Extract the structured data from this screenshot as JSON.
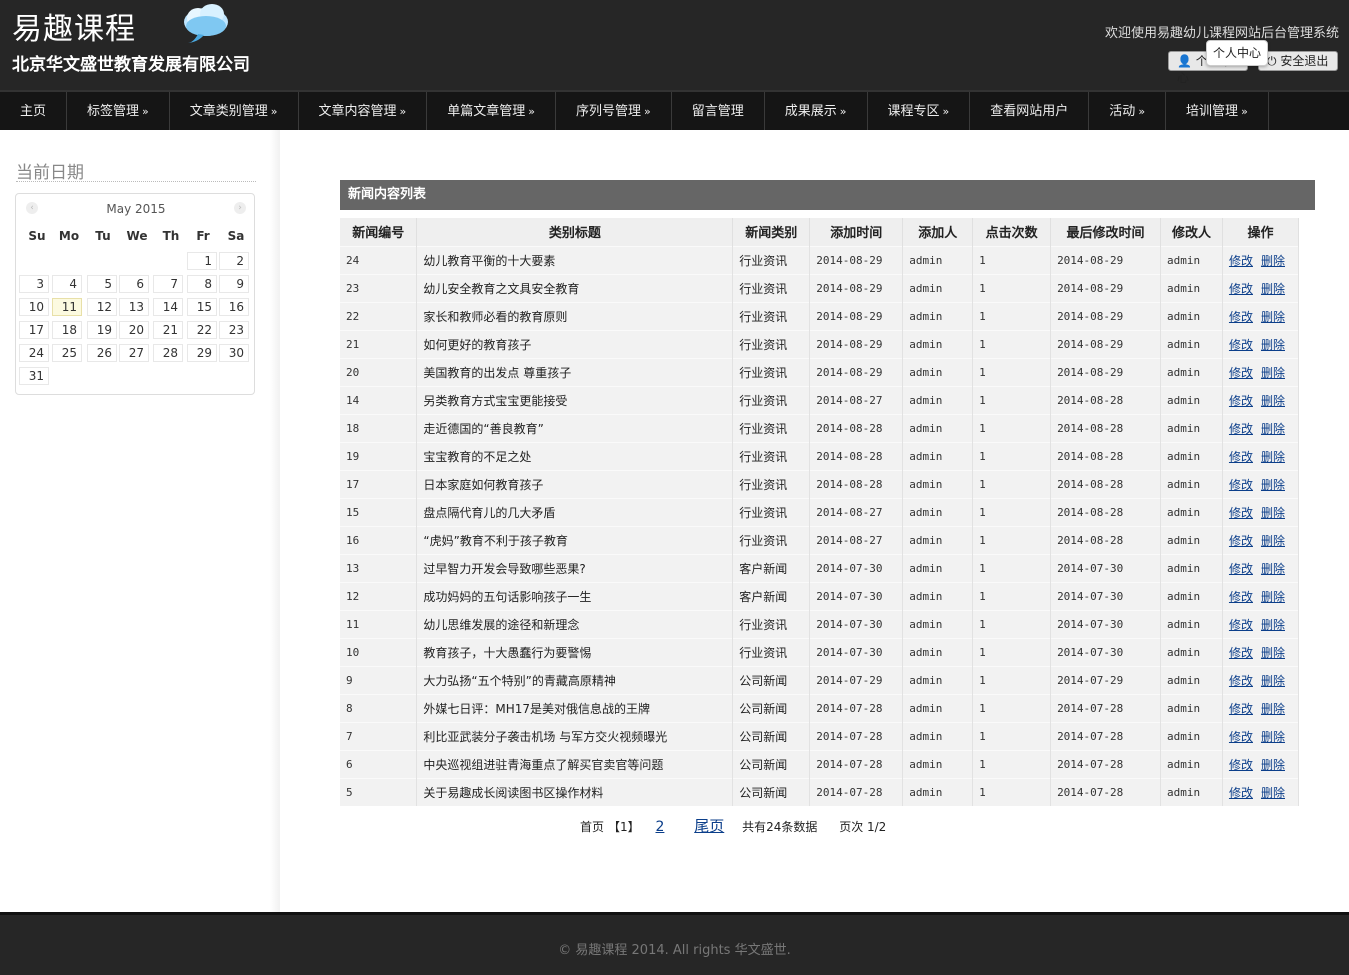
{
  "header": {
    "brand": "易趣课程",
    "company": "北京华文盛世教育发展有限公司",
    "welcome": "欢迎使用易趣幼儿课程网站后台管理系统",
    "profile_button": "个人中心",
    "logout_button": "安全退出",
    "tooltip": "个人中心"
  },
  "nav": [
    {
      "label": "主页",
      "arrow": ""
    },
    {
      "label": "标签管理",
      "arrow": "»"
    },
    {
      "label": "文章类别管理",
      "arrow": "»"
    },
    {
      "label": "文章内容管理",
      "arrow": "»"
    },
    {
      "label": "单篇文章管理",
      "arrow": "»"
    },
    {
      "label": "序列号管理",
      "arrow": "»"
    },
    {
      "label": "留言管理",
      "arrow": ""
    },
    {
      "label": "成果展示",
      "arrow": "»"
    },
    {
      "label": "课程专区",
      "arrow": "»"
    },
    {
      "label": "查看网站用户",
      "arrow": ""
    },
    {
      "label": "活动",
      "arrow": "»"
    },
    {
      "label": "培训管理",
      "arrow": "»"
    }
  ],
  "sidebar": {
    "title": "当前日期",
    "calendar": {
      "month_label": "May 2015",
      "prev_icon": "‹",
      "next_icon": "›",
      "weekdays": [
        "Su",
        "Mo",
        "Tu",
        "We",
        "Th",
        "Fr",
        "Sa"
      ],
      "first_weekday_index": 5,
      "days_in_month": 31,
      "today": 11
    }
  },
  "table": {
    "title": "新闻内容列表",
    "columns": [
      "新闻编号",
      "类别标题",
      "新闻类别",
      "添加时间",
      "添加人",
      "点击次数",
      "最后修改时间",
      "修改人",
      "操作"
    ],
    "edit_label": "修改",
    "delete_label": "删除",
    "rows": [
      [
        "24",
        "幼儿教育平衡的十大要素",
        "行业资讯",
        "2014-08-29",
        "admin",
        "1",
        "2014-08-29",
        "admin"
      ],
      [
        "23",
        "幼儿安全教育之文具安全教育",
        "行业资讯",
        "2014-08-29",
        "admin",
        "1",
        "2014-08-29",
        "admin"
      ],
      [
        "22",
        "家长和教师必看的教育原则",
        "行业资讯",
        "2014-08-29",
        "admin",
        "1",
        "2014-08-29",
        "admin"
      ],
      [
        "21",
        "如何更好的教育孩子",
        "行业资讯",
        "2014-08-29",
        "admin",
        "1",
        "2014-08-29",
        "admin"
      ],
      [
        "20",
        "美国教育的出发点 尊重孩子",
        "行业资讯",
        "2014-08-29",
        "admin",
        "1",
        "2014-08-29",
        "admin"
      ],
      [
        "14",
        "另类教育方式宝宝更能接受",
        "行业资讯",
        "2014-08-27",
        "admin",
        "1",
        "2014-08-28",
        "admin"
      ],
      [
        "18",
        "走近德国的“善良教育”",
        "行业资讯",
        "2014-08-28",
        "admin",
        "1",
        "2014-08-28",
        "admin"
      ],
      [
        "19",
        "宝宝教育的不足之处",
        "行业资讯",
        "2014-08-28",
        "admin",
        "1",
        "2014-08-28",
        "admin"
      ],
      [
        "17",
        "日本家庭如何教育孩子",
        "行业资讯",
        "2014-08-28",
        "admin",
        "1",
        "2014-08-28",
        "admin"
      ],
      [
        "15",
        "盘点隔代育儿的几大矛盾",
        "行业资讯",
        "2014-08-27",
        "admin",
        "1",
        "2014-08-28",
        "admin"
      ],
      [
        "16",
        "“虎妈”教育不利于孩子教育",
        "行业资讯",
        "2014-08-27",
        "admin",
        "1",
        "2014-08-28",
        "admin"
      ],
      [
        "13",
        "过早智力开发会导致哪些恶果?",
        "客户新闻",
        "2014-07-30",
        "admin",
        "1",
        "2014-07-30",
        "admin"
      ],
      [
        "12",
        "成功妈妈的五句话影响孩子一生",
        "客户新闻",
        "2014-07-30",
        "admin",
        "1",
        "2014-07-30",
        "admin"
      ],
      [
        "11",
        "幼儿思维发展的途径和新理念",
        "行业资讯",
        "2014-07-30",
        "admin",
        "1",
        "2014-07-30",
        "admin"
      ],
      [
        "10",
        "教育孩子，十大愚蠢行为要警惕",
        "行业资讯",
        "2014-07-30",
        "admin",
        "1",
        "2014-07-30",
        "admin"
      ],
      [
        "9",
        "大力弘扬“五个特别”的青藏高原精神",
        "公司新闻",
        "2014-07-29",
        "admin",
        "1",
        "2014-07-29",
        "admin"
      ],
      [
        "8",
        "外媒七日评：MH17是美对俄信息战的王牌",
        "公司新闻",
        "2014-07-28",
        "admin",
        "1",
        "2014-07-28",
        "admin"
      ],
      [
        "7",
        "利比亚武装分子袭击机场 与军方交火视频曝光",
        "公司新闻",
        "2014-07-28",
        "admin",
        "1",
        "2014-07-28",
        "admin"
      ],
      [
        "6",
        "中央巡视组进驻青海重点了解买官卖官等问题",
        "公司新闻",
        "2014-07-28",
        "admin",
        "1",
        "2014-07-28",
        "admin"
      ],
      [
        "5",
        "关于易趣成长阅读图书区操作材料",
        "公司新闻",
        "2014-07-28",
        "admin",
        "1",
        "2014-07-28",
        "admin"
      ]
    ]
  },
  "pager": {
    "first": "首页",
    "current": "【1】",
    "page2": "2",
    "last": "尾页",
    "total": "共有24条数据",
    "page_info": "页次 1/2"
  },
  "footer": {
    "copyright": "© 易趣课程 2014. All rights 华文盛世."
  }
}
